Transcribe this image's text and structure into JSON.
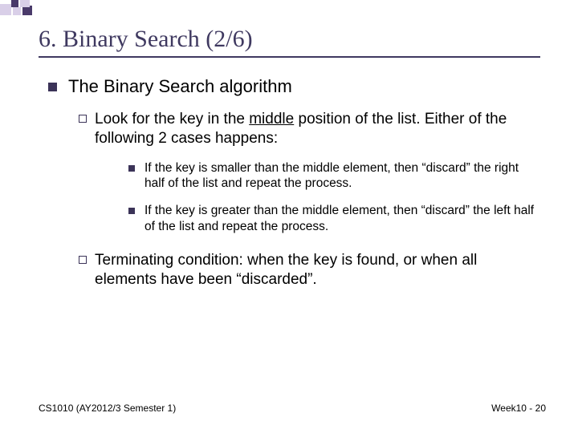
{
  "decor_colors": {
    "light": "#d9cfe8",
    "dark": "#4a3a6a"
  },
  "title": "6. Binary Search (2/6)",
  "content": {
    "heading": "The Binary Search algorithm",
    "point1_lead": "Look",
    "point1_rest_a": " for the key in the ",
    "point1_middle": "middle",
    "point1_rest_b": " position of the list. Either of the following 2 cases happens:",
    "sub1": "If the key is smaller than the middle element, then “discard” the right half of the list and repeat the process.",
    "sub2": "If the key is greater than the middle element, then “discard” the left half of the list and repeat the process.",
    "point2_lead": "Terminating",
    "point2_rest": " condition: when the key is found, or when all elements have been “discarded”."
  },
  "footer": {
    "left": "CS1010 (AY2012/3 Semester 1)",
    "right": "Week10 - 20"
  }
}
